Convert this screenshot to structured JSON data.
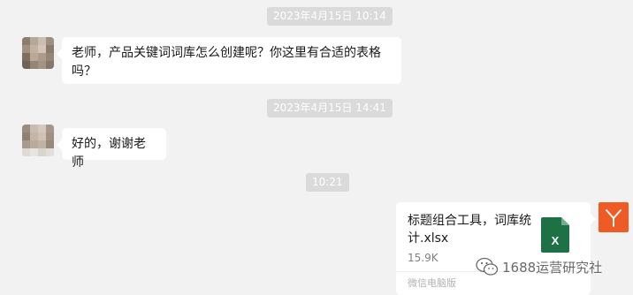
{
  "timestamps": [
    "2023年4月15日 10:14",
    "2023年4月15日 14:41",
    "10:21"
  ],
  "messages": [
    {
      "text": "老师，产品关键词词库怎么创建呢？你这里有合适的表格吗？"
    },
    {
      "text": "好的，谢谢老师"
    }
  ],
  "file": {
    "name": "标题组合工具，词库统计.xlsx",
    "size": "15.9K",
    "source": "微信电脑版",
    "icon": "excel-file-icon",
    "icon_letter": "X",
    "icon_color": "#1e7145"
  },
  "self_avatar": {
    "icon": "y-logo-icon",
    "color": "#f05a24"
  },
  "watermark": {
    "icon": "wechat-icon",
    "text": "1688运营研究社"
  },
  "colors": {
    "background": "#f2f2f2",
    "bubble": "#ffffff",
    "timestamp_bg": "#dadada"
  }
}
